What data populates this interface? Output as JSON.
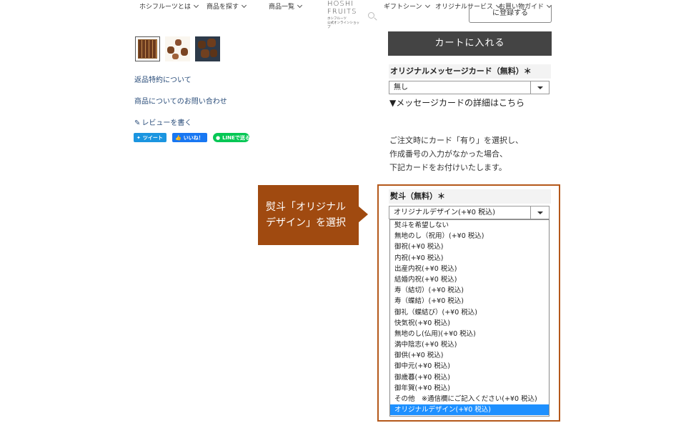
{
  "nav": {
    "items": [
      {
        "label": "ホシフルーツとは"
      },
      {
        "label": "商品を探す"
      },
      {
        "label": "商品一覧"
      },
      {
        "label": "ギフトシーン"
      },
      {
        "label": "オリジナルサービス"
      },
      {
        "label": "お買い物ガイド"
      }
    ],
    "logo_line1": "HOSHI",
    "logo_line2": "FRUITS",
    "logo_sub1": "ホシフルーツ",
    "logo_sub2": "公式オンラインショップ",
    "register_label": "に登録する"
  },
  "left": {
    "return_policy": "返品特約について",
    "contact": "商品についてのお問い合わせ",
    "review": "レビューを書く",
    "tweet": "ツイート",
    "like": "いいね！",
    "line": "LINEで送る"
  },
  "cart": {
    "label": "カートに入れる"
  },
  "message_card": {
    "label": "オリジナルメッセージカード（無料）＊",
    "value": "無し",
    "detail_link": "▼メッセージカードの詳細はこちら",
    "note_lines": [
      "ご注文時にカード「有り」を選択し、",
      "作成番号の入力がなかった場合、",
      "下記カードをお付けいたします。"
    ]
  },
  "noshi": {
    "label": "熨斗（無料）＊",
    "value": "オリジナルデザイン(+¥0 税込)",
    "options": [
      "熨斗を希望しない",
      "無地のし（祝用）(+¥0 税込)",
      "御祝(+¥0 税込)",
      "内祝(+¥0 税込)",
      "出産内祝(+¥0 税込)",
      "結婚内祝(+¥0 税込)",
      "寿（結切）(+¥0 税込)",
      "寿（蝶結）(+¥0 税込)",
      "御礼（蝶結び）(+¥0 税込)",
      "快気祝(+¥0 税込)",
      "無地のし(仏用)(+¥0 税込)",
      "満中陰志(+¥0 税込)",
      "御供(+¥0 税込)",
      "御中元(+¥0 税込)",
      "御歳暮(+¥0 税込)",
      "御年賀(+¥0 税込)",
      "その他　※通信欄にご記入ください(+¥0 税込)",
      "オリジナルデザイン(+¥0 税込)"
    ],
    "selected_index": 17
  },
  "callout": {
    "line1": "熨斗「オリジナル",
    "line2": "デザイン」を選択"
  },
  "colors": {
    "accent": "#b4581a",
    "callout_bg": "#a04a10",
    "cart_bg": "#444444",
    "selected_option": "#1e90ff"
  }
}
